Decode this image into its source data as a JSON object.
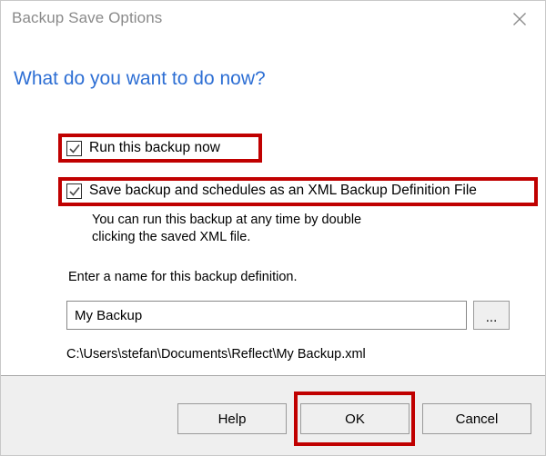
{
  "window": {
    "title": "Backup Save Options",
    "close_icon": "close-x-icon"
  },
  "heading": "What do you want to do now?",
  "options": [
    {
      "id": "run-backup-now",
      "label": "Run this backup now",
      "checked": true,
      "annotated": true
    },
    {
      "id": "save-xml-definition",
      "label": "Save backup and schedules as an XML Backup Definition File",
      "checked": true,
      "annotated": true
    }
  ],
  "help_text": "You can run this backup at any time by double clicking the saved XML file.",
  "name_field": {
    "label": "Enter a name for this backup definition.",
    "value": "My Backup",
    "placeholder": "",
    "browse_label": "..."
  },
  "path_preview": "C:\\Users\\stefan\\Documents\\Reflect\\My Backup.xml",
  "footer": {
    "help_label": "Help",
    "ok_label": "OK",
    "cancel_label": "Cancel"
  },
  "colors": {
    "heading_blue": "#2e6fd4",
    "annotation_red": "#c00000",
    "title_gray": "#8a8a8a",
    "footer_gray": "#efefef"
  }
}
